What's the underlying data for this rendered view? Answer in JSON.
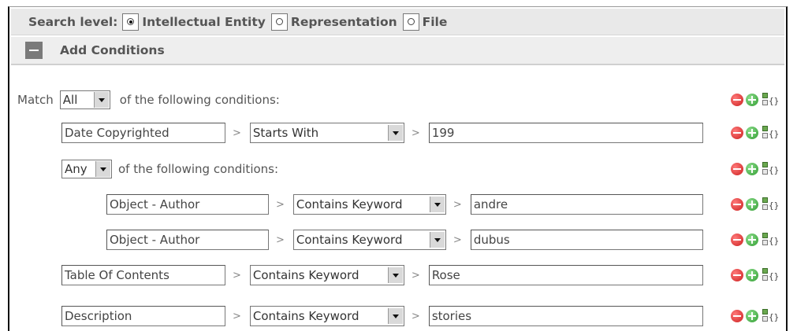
{
  "search": {
    "label": "Search level:",
    "options": [
      {
        "label": "Intellectual Entity",
        "checked": true
      },
      {
        "label": "Representation",
        "checked": false
      },
      {
        "label": "File",
        "checked": false
      }
    ]
  },
  "section": {
    "title": "Add Conditions"
  },
  "root": {
    "match_prefix": "Match",
    "match_value": "All",
    "match_suffix": "of the following conditions:"
  },
  "rows": [
    {
      "field": "Date Copyrighted",
      "operator": "Starts With",
      "value": "199"
    },
    {
      "group_value": "Any",
      "group_suffix": "of the following conditions:"
    },
    {
      "field": "Object - Author",
      "operator": "Contains Keyword",
      "value": "andre"
    },
    {
      "field": "Object - Author",
      "operator": "Contains Keyword",
      "value": "dubus"
    },
    {
      "field": "Table Of Contents",
      "operator": "Contains Keyword",
      "value": "Rose"
    },
    {
      "field": "Description",
      "operator": "Contains Keyword",
      "value": "stories"
    }
  ],
  "separator": ">",
  "icons": {
    "remove": "remove-condition-icon",
    "add": "add-condition-icon",
    "group": "add-group-icon"
  },
  "colors": {
    "remove": "#d62828",
    "add": "#3aa83a",
    "header_bg": "#e9e9e9"
  }
}
